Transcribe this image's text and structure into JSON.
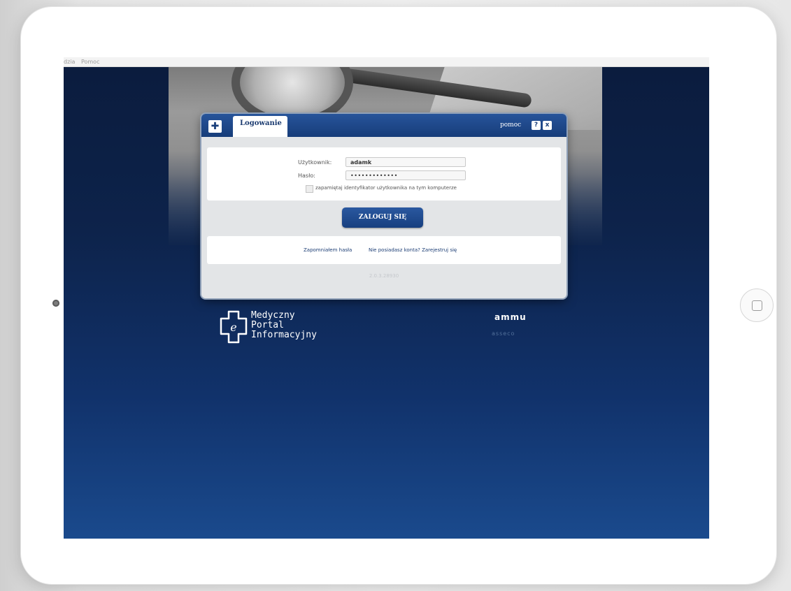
{
  "menu": {
    "items": [
      "dzia",
      "Pomoc"
    ]
  },
  "dialog": {
    "tab_label": "Logowanie",
    "help_label": "pomoc",
    "help_button": "?",
    "close_button": "x",
    "user_label": "Użytkownik:",
    "user_value": "adamk",
    "password_label": "Hasło:",
    "password_value": "•••••••••••••",
    "remember_label": "zapamiętaj identyfikator użytkownika na tym komputerze",
    "login_button": "ZALOGUJ SIĘ",
    "forgot_link": "Zapomniałem hasła",
    "register_link": "Nie posiadasz konta? Zarejestruj się",
    "version": "2.0.3.28930"
  },
  "branding": {
    "logo_letter": "e",
    "line1": "Medyczny",
    "line2": "Portal",
    "line3": "Informacyjny",
    "partner1": "ammu",
    "partner2": "asseco"
  },
  "colors": {
    "primary": "#173d7a",
    "screen_bg": "#0d234b"
  }
}
